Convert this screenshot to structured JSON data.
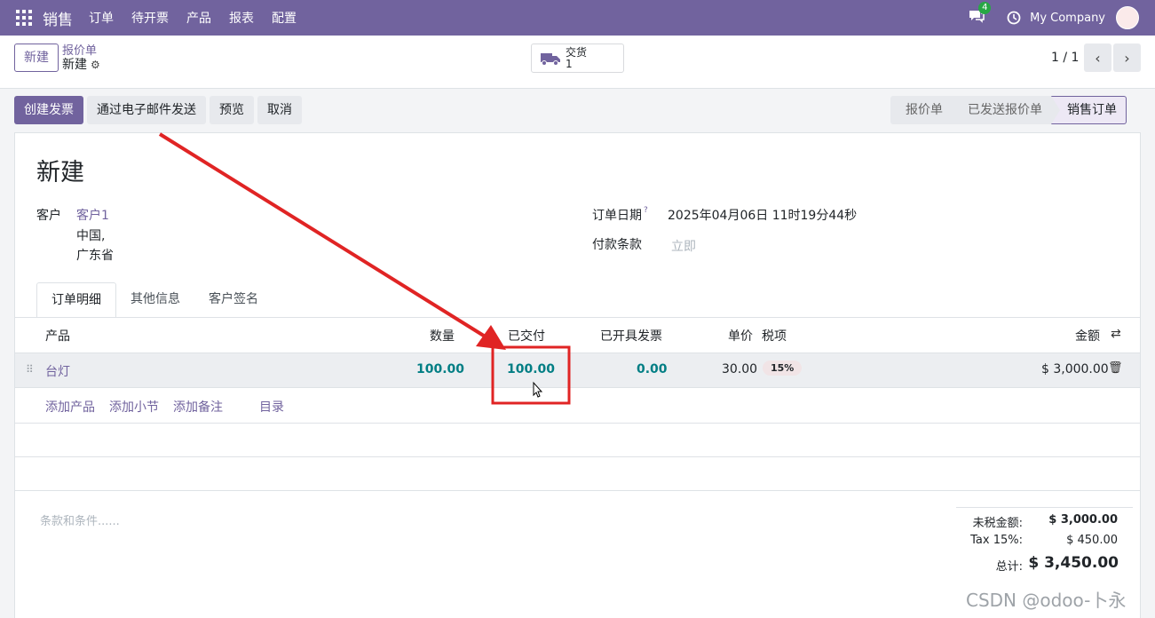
{
  "navbar": {
    "brand": "销售",
    "menu": [
      "订单",
      "待开票",
      "产品",
      "报表",
      "配置"
    ],
    "chat_count": "4",
    "company": "My Company"
  },
  "control": {
    "new_label": "新建",
    "breadcrumb_parent": "报价单",
    "breadcrumb_current": "新建",
    "smart_button_label": "交货",
    "smart_button_value": "1",
    "pager": "1 / 1"
  },
  "actions": [
    "创建发票",
    "通过电子邮件发送",
    "预览",
    "取消"
  ],
  "status_stages": [
    "报价单",
    "已发送报价单",
    "销售订单"
  ],
  "form": {
    "title": "新建",
    "customer_label": "客户",
    "customer_name": "客户1",
    "customer_addr1": "中国,",
    "customer_addr2": "广东省",
    "date_label": "订单日期",
    "date_help": "?",
    "date_value": "2025年04月06日 11时19分44秒",
    "payment_label": "付款条款",
    "payment_placeholder": "立即"
  },
  "tabs": [
    "订单明细",
    "其他信息",
    "客户签名"
  ],
  "table": {
    "headers": {
      "product": "产品",
      "qty": "数量",
      "delivered": "已交付",
      "invoiced": "已开具发票",
      "price": "单价",
      "tax": "税项",
      "amount": "金额"
    },
    "row": {
      "product": "台灯",
      "qty": "100.00",
      "delivered": "100.00",
      "invoiced": "0.00",
      "price": "30.00",
      "tax": "15%",
      "amount": "$ 3,000.00"
    },
    "add_links": [
      "添加产品",
      "添加小节",
      "添加备注",
      "目录"
    ]
  },
  "terms_placeholder": "条款和条件......",
  "totals": {
    "untaxed_label": "未税金额:",
    "untaxed_value": "$ 3,000.00",
    "tax_label": "Tax 15%:",
    "tax_value": "$ 450.00",
    "total_label": "总计:",
    "total_value": "$ 3,450.00"
  },
  "watermark": "CSDN @odoo-卜永",
  "colors": {
    "brand": "#71639e",
    "numeric": "#017e84",
    "annotation": "#e02424"
  }
}
